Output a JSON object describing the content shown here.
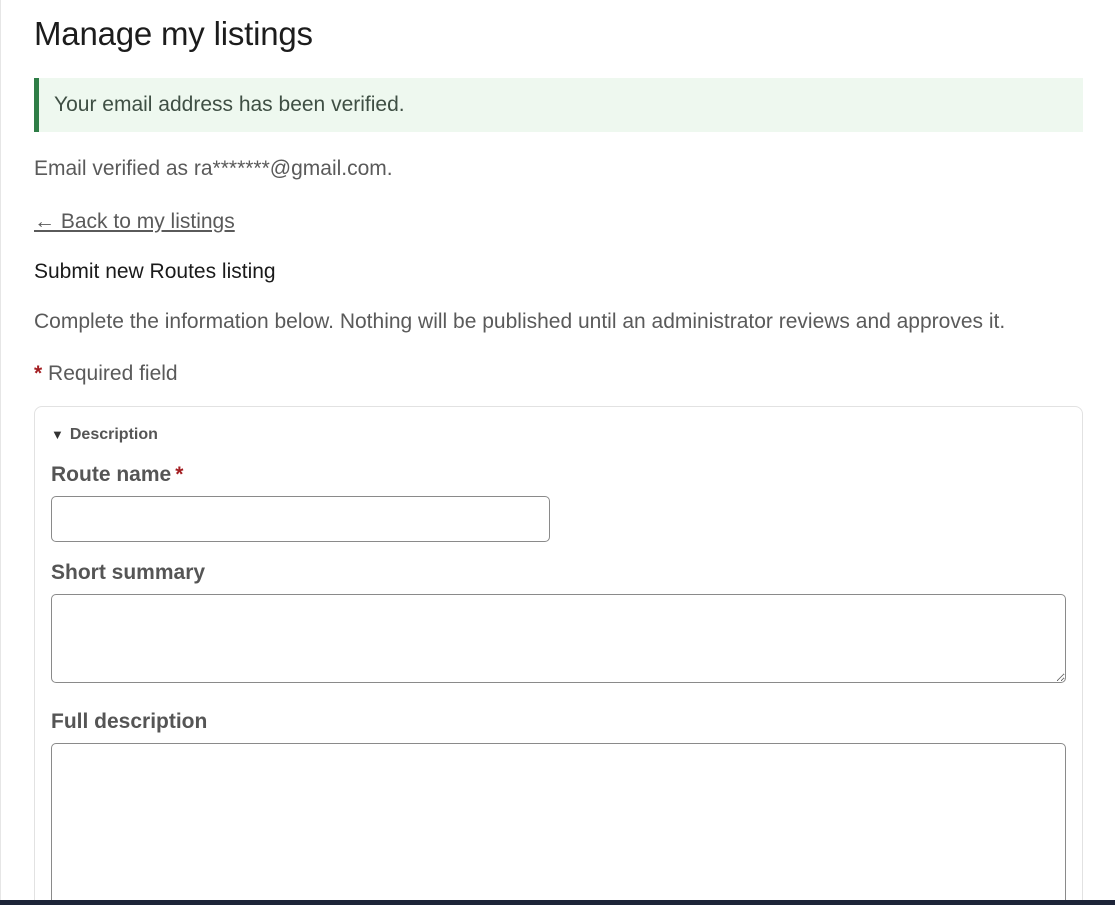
{
  "page": {
    "title": "Manage my listings"
  },
  "alert": {
    "message": "Your email address has been verified."
  },
  "verified": {
    "text": "Email verified as ra*******@gmail.com."
  },
  "nav": {
    "back_link": "← Back to my listings"
  },
  "form": {
    "heading": "Submit new Routes listing",
    "intro": "Complete the information below. Nothing will be published until an administrator reviews and approves it.",
    "required_marker": "*",
    "required_note": "Required field",
    "section": {
      "toggle_glyph": "▼",
      "title": "Description"
    },
    "fields": {
      "route_name": {
        "label": "Route name",
        "value": ""
      },
      "short_summary": {
        "label": "Short summary",
        "value": ""
      },
      "full_description": {
        "label": "Full description",
        "value": ""
      }
    }
  },
  "colors": {
    "alert_background": "#eef8ef",
    "alert_border": "#2e7d46",
    "required_star": "#a31e22",
    "muted_text": "#5a5a5a"
  }
}
